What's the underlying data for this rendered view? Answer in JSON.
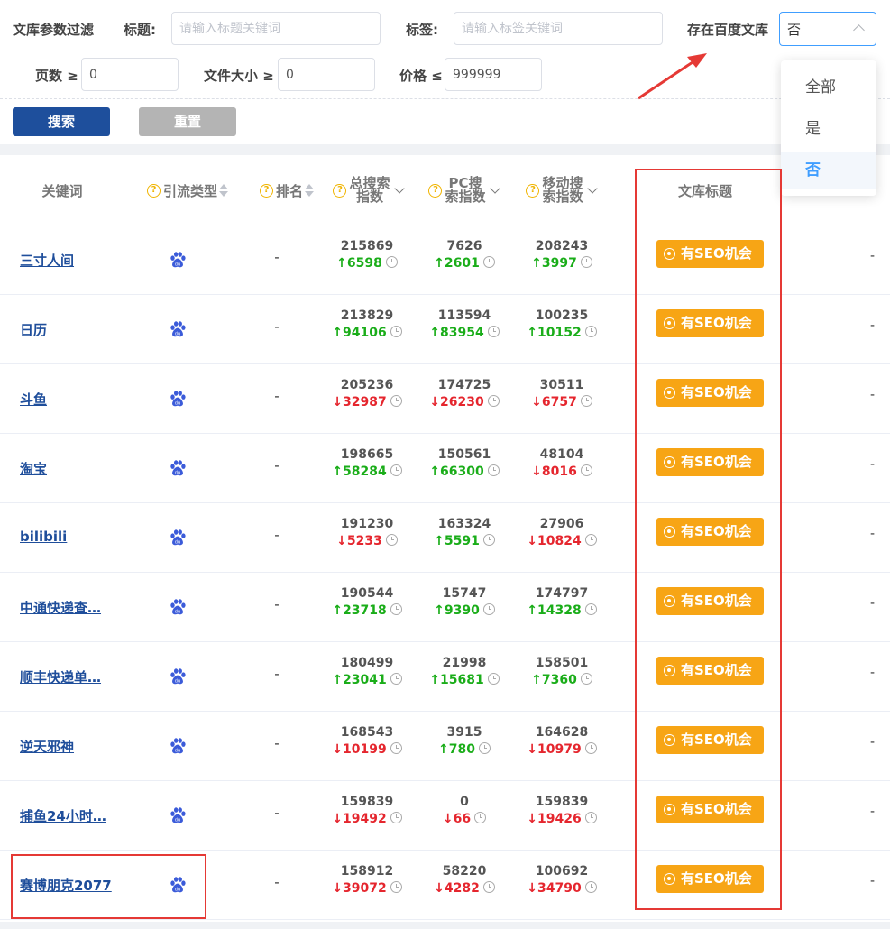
{
  "filters": {
    "section_label": "文库参数过滤",
    "title_label": "标题:",
    "title_placeholder": "请输入标题关键词",
    "tag_label": "标签:",
    "tag_placeholder": "请输入标签关键词",
    "baidu_label": "存在百度文库",
    "baidu_value": "否",
    "pages_label": "页数 ≥",
    "pages_value": "0",
    "size_label": "文件大小 ≥",
    "size_value": "0",
    "price_label": "价格 ≤",
    "price_value": "999999",
    "search_button": "搜索",
    "reset_button": "重置"
  },
  "dropdown": {
    "options": [
      "全部",
      "是",
      "否"
    ],
    "selected": "否"
  },
  "table": {
    "headers": {
      "keyword": "关键词",
      "traffic_type": "引流类型",
      "rank": "排名",
      "total_line1": "总搜索",
      "total_line2": "指数",
      "pc_line1": "PC搜",
      "pc_line2": "索指数",
      "mobile_line1": "移动搜",
      "mobile_line2": "索指数",
      "doc_title": "文库标题"
    },
    "seo_label": "有SEO机会",
    "rows": [
      {
        "keyword": "三寸人间",
        "rank": "-",
        "total": "215869",
        "total_chg": "6598",
        "total_dir": "up",
        "pc": "7626",
        "pc_chg": "2601",
        "pc_dir": "up",
        "mobile": "208243",
        "mobile_chg": "3997",
        "mobile_dir": "up",
        "last": "-"
      },
      {
        "keyword": "日历",
        "rank": "-",
        "total": "213829",
        "total_chg": "94106",
        "total_dir": "up",
        "pc": "113594",
        "pc_chg": "83954",
        "pc_dir": "up",
        "mobile": "100235",
        "mobile_chg": "10152",
        "mobile_dir": "up",
        "last": "-"
      },
      {
        "keyword": "斗鱼",
        "rank": "-",
        "total": "205236",
        "total_chg": "32987",
        "total_dir": "down",
        "pc": "174725",
        "pc_chg": "26230",
        "pc_dir": "down",
        "mobile": "30511",
        "mobile_chg": "6757",
        "mobile_dir": "down",
        "last": "-"
      },
      {
        "keyword": "淘宝",
        "rank": "-",
        "total": "198665",
        "total_chg": "58284",
        "total_dir": "up",
        "pc": "150561",
        "pc_chg": "66300",
        "pc_dir": "up",
        "mobile": "48104",
        "mobile_chg": "8016",
        "mobile_dir": "down",
        "last": "-"
      },
      {
        "keyword": "bilibili",
        "rank": "-",
        "total": "191230",
        "total_chg": "5233",
        "total_dir": "down",
        "pc": "163324",
        "pc_chg": "5591",
        "pc_dir": "up",
        "mobile": "27906",
        "mobile_chg": "10824",
        "mobile_dir": "down",
        "last": "-"
      },
      {
        "keyword": "中通快递查…",
        "rank": "-",
        "total": "190544",
        "total_chg": "23718",
        "total_dir": "up",
        "pc": "15747",
        "pc_chg": "9390",
        "pc_dir": "up",
        "mobile": "174797",
        "mobile_chg": "14328",
        "mobile_dir": "up",
        "last": "-"
      },
      {
        "keyword": "顺丰快递单…",
        "rank": "-",
        "total": "180499",
        "total_chg": "23041",
        "total_dir": "up",
        "pc": "21998",
        "pc_chg": "15681",
        "pc_dir": "up",
        "mobile": "158501",
        "mobile_chg": "7360",
        "mobile_dir": "up",
        "last": "-"
      },
      {
        "keyword": "逆天邪神",
        "rank": "-",
        "total": "168543",
        "total_chg": "10199",
        "total_dir": "down",
        "pc": "3915",
        "pc_chg": "780",
        "pc_dir": "up",
        "mobile": "164628",
        "mobile_chg": "10979",
        "mobile_dir": "down",
        "last": "-"
      },
      {
        "keyword": "捕鱼24小时…",
        "rank": "-",
        "total": "159839",
        "total_chg": "19492",
        "total_dir": "down",
        "pc": "0",
        "pc_chg": "66",
        "pc_dir": "down",
        "mobile": "159839",
        "mobile_chg": "19426",
        "mobile_dir": "down",
        "last": "-"
      },
      {
        "keyword": "赛博朋克2077",
        "rank": "-",
        "total": "158912",
        "total_chg": "39072",
        "total_dir": "down",
        "pc": "58220",
        "pc_chg": "4282",
        "pc_dir": "down",
        "mobile": "100692",
        "mobile_chg": "34790",
        "mobile_dir": "down",
        "last": "-"
      }
    ]
  },
  "colors": {
    "up": "#1aad19",
    "down": "#e5262e",
    "seo_badge": "#f7a515",
    "primary_button": "#1e4f9c",
    "link": "#1f4e9b",
    "annotation": "#e53935"
  },
  "icons": {
    "traffic_type": "baidu-paw-icon",
    "help": "question-circle-icon",
    "trend": "clock-icon"
  }
}
